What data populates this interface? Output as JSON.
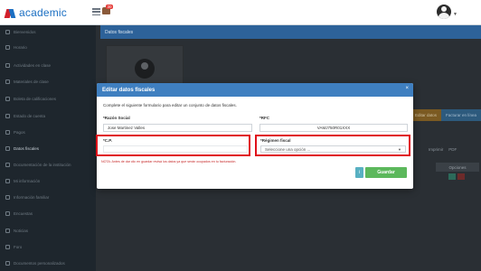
{
  "app": {
    "logo_text": "academic",
    "notification_count": "30"
  },
  "sidebar": {
    "items": [
      {
        "label": "Bienvenidos",
        "active": false
      },
      {
        "label": "Horario",
        "active": false
      },
      {
        "label": "Actividades en clase",
        "active": false
      },
      {
        "label": "Materiales de clase",
        "active": false
      },
      {
        "label": "Boleta de calificaciones",
        "active": false
      },
      {
        "label": "Estado de cuenta",
        "active": false
      },
      {
        "label": "Pagos",
        "active": false
      },
      {
        "label": "Datos fiscales",
        "active": true
      },
      {
        "label": "Documentación de la institución",
        "active": false
      },
      {
        "label": "Mi información",
        "active": false
      },
      {
        "label": "Información familiar",
        "active": false
      },
      {
        "label": "Encuestas",
        "active": false
      },
      {
        "label": "Noticias",
        "active": false
      },
      {
        "label": "Foro",
        "active": false
      },
      {
        "label": "Documentos personalizados",
        "active": false
      }
    ]
  },
  "main": {
    "panel_title": "Datos fiscales",
    "bg_button_orange": "Editar datos",
    "bg_button_blue": "Facturar en línea",
    "tools": {
      "print": "Imprimir",
      "pdf": "PDF"
    },
    "table_header": "Opciones"
  },
  "modal": {
    "title": "Editar datos fiscales",
    "close": "×",
    "description": "Complete el siguiente formulario para editar un conjunto de datos fiscales.",
    "razon_social": {
      "label": "*Razón Social",
      "value": "Jose Martinez Valles"
    },
    "rfc": {
      "label": "*RFC",
      "value": "VAMJ750R01XXX"
    },
    "cp": {
      "label": "*C.P.",
      "value": ""
    },
    "regimen": {
      "label": "*Régimen fiscal",
      "placeholder": "Seleccione una opción ..."
    },
    "note": "NOTA: Antes de dar clic en guardar revisá los datos ya que serán ocupados en tu facturación.",
    "info_label": "i",
    "save_label": "Guardar"
  },
  "colors": {
    "modal_header": "#3f7fc0",
    "save_button": "#5cb85c",
    "highlight": "#e0101a",
    "info_button": "#58b0c2"
  }
}
